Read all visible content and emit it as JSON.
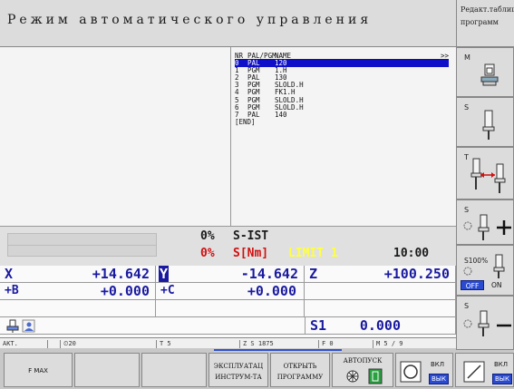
{
  "header": {
    "title": "Режим автоматического управления",
    "prog_edit_line1": "Редакт.таблицы",
    "prog_edit_line2": "программ"
  },
  "pallet_table": {
    "columns": [
      "NR",
      "PAL/PGM",
      "NAME"
    ],
    "more_marker": ">>",
    "rows": [
      {
        "nr": "0",
        "type": "PAL",
        "name": "120"
      },
      {
        "nr": "1",
        "type": "PGM",
        "name": "1.H"
      },
      {
        "nr": "2",
        "type": "PAL",
        "name": "130"
      },
      {
        "nr": "3",
        "type": "PGM",
        "name": "SLOLD.H"
      },
      {
        "nr": "4",
        "type": "PGM",
        "name": "FK1.H"
      },
      {
        "nr": "5",
        "type": "PGM",
        "name": "SLOLD.H"
      },
      {
        "nr": "6",
        "type": "PGM",
        "name": "SLOLD.H"
      },
      {
        "nr": "7",
        "type": "PAL",
        "name": "140"
      }
    ],
    "end_marker": "[END]"
  },
  "spindle": {
    "s_ist_pct": "0%",
    "s_ist_label": "S-IST",
    "s_nm_pct": "0%",
    "s_nm_label": "S[Nm]",
    "limit_label": "LIMIT 1",
    "clock": "10:00"
  },
  "positions": {
    "x_label": "X",
    "x_value": "+14.642",
    "y_label": "Y",
    "y_value": "-14.642",
    "z_label": "Z",
    "z_value": "+100.250",
    "b_label": "+B",
    "b_value": "+0.000",
    "c_label": "+C",
    "c_value": "+0.000",
    "s1_label": "S1",
    "s1_value": "0.000"
  },
  "status_bar": {
    "mode": "АКТ.",
    "t_time": "20",
    "tool": "T 5",
    "z_s": "Z S 1875",
    "feed": "F 0",
    "m_code": "M 5 / 9"
  },
  "right_softkeys": {
    "m_label": "M",
    "s_label": "S",
    "t_label": "T",
    "s_plus_label": "S",
    "s100_label": "S100%",
    "off_label": "OFF",
    "on_label": "ON",
    "s_minus_label": "S"
  },
  "bottom_softkeys": {
    "fmax": "F MAX",
    "exploit_line1": "ЭКСПЛУАТАЦ",
    "exploit_line2": "ИНСТРУМ-ТА",
    "open_line1": "ОТКРЫТЬ",
    "open_line2": "ПРОГРАММУ",
    "autostart": "АВТОПУСК",
    "vkl1": "ВКЛ",
    "vyk1": "ВЫК",
    "vkl2": "ВКЛ",
    "vyk2": "ВЫК"
  },
  "colors": {
    "axis_blue": "#1a1aa0",
    "selection_blue": "#1010c8",
    "limit_yellow": "#ffff40",
    "s_nm_red": "#d01010"
  }
}
